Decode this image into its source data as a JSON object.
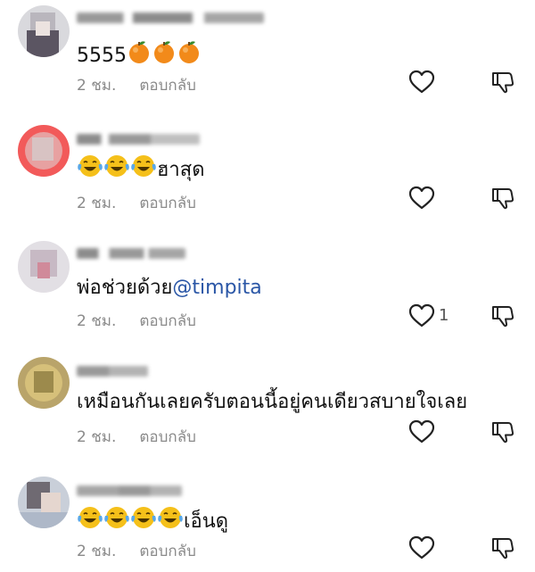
{
  "comments": [
    {
      "text_before": "5555",
      "emoji": [
        "orange",
        "orange",
        "orange"
      ],
      "emoji_after": true,
      "text_after": "",
      "mention": "",
      "time": "2 ชม.",
      "reply_label": "ตอบกลับ",
      "likes": ""
    },
    {
      "text_before": "",
      "emoji": [
        "laugh-cry",
        "laugh-cry",
        "laugh-cry"
      ],
      "text_after": "ฮาสุด",
      "mention": "",
      "time": "2 ชม.",
      "reply_label": "ตอบกลับ",
      "likes": ""
    },
    {
      "text_before": "พ่อช่วยด้วย",
      "emoji": [],
      "text_after": "",
      "mention": "@timpita",
      "time": "2 ชม.",
      "reply_label": "ตอบกลับ",
      "likes": "1"
    },
    {
      "text_before": "เหมือนกันเลยครับตอนนี้อยู่คนเดียวสบายใจเลย",
      "emoji": [],
      "text_after": "",
      "mention": "",
      "time": "2 ชม.",
      "reply_label": "ตอบกลับ",
      "likes": ""
    },
    {
      "text_before": "",
      "emoji": [
        "laugh-cry",
        "laugh-cry",
        "laugh-cry",
        "laugh-cry"
      ],
      "text_after": "เอ็นดู",
      "mention": "",
      "time": "2 ชม.",
      "reply_label": "ตอบกลับ",
      "likes": ""
    }
  ],
  "icons": {
    "like": "heart-outline-icon",
    "dislike": "thumbs-down-outline-icon"
  },
  "colors": {
    "mention": "#2a56a6",
    "meta_text": "#8a8a8a"
  }
}
